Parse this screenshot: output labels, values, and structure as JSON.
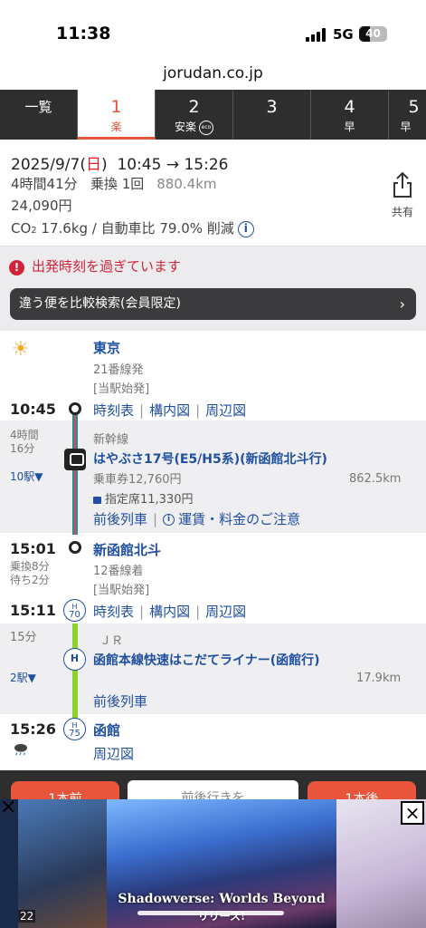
{
  "status_bar": {
    "time": "11:38",
    "network": "5G",
    "battery": "40"
  },
  "browser": {
    "url": "jorudan.co.jp"
  },
  "tabs": [
    {
      "num": "一覧",
      "sub": ""
    },
    {
      "num": "1",
      "sub": "楽"
    },
    {
      "num": "2",
      "sub": "安楽"
    },
    {
      "num": "3",
      "sub": ""
    },
    {
      "num": "4",
      "sub": "早"
    },
    {
      "num": "5",
      "sub": "早"
    }
  ],
  "tab_eco_label": "eco",
  "summary": {
    "date": "2025/9/7(",
    "weekday": "日",
    "date_close": ")",
    "times": "10:45 → 15:26",
    "duration": "4時間41分",
    "transfers": "乗換 1回",
    "distance": "880.4km",
    "fare": "24,090円",
    "co2_a": "CO",
    "co2_b": "2",
    "co2_c": " 17.6kg / 自動車比 79.0% 削減",
    "info_icon": "i",
    "share_label": "共有"
  },
  "warning": {
    "bang": "!",
    "text": "出発時刻を過ぎています"
  },
  "compare": {
    "label": "違う便を比較検索(会員限定)",
    "chevron": "›"
  },
  "route": {
    "weather_start": "sun-icon",
    "station1": {
      "name": "東京",
      "platform": "21番線発",
      "note": "[当駅始発]",
      "time": "10:45",
      "links": [
        "時刻表",
        "構内図",
        "周辺図"
      ]
    },
    "seg1": {
      "duration_a": "4時間",
      "duration_b": "16分",
      "stops": "10駅▼",
      "line_type": "新幹線",
      "train": "はやぶさ17号(E5/H5系)(新函館北斗行)",
      "ticket": "乗車券12,760円",
      "km": "862.5km",
      "reserved": "指定席11,330円",
      "links_a": "前後列車",
      "links_b": "運賃・料金のご注意",
      "info_icon": "i"
    },
    "station2": {
      "name": "新函館北斗",
      "time_arr": "15:01",
      "transfer_a": "乗換8分",
      "transfer_b": "待ち2分",
      "platform": "12番線着",
      "note": "[当駅始発]",
      "time_dep": "15:11",
      "badge_a": "H",
      "badge_b": "70",
      "links": [
        "時刻表",
        "構内図",
        "周辺図"
      ]
    },
    "seg2": {
      "duration": "15分",
      "stops": "2駅▼",
      "operator": "ＪＲ",
      "badge": "H",
      "train": "函館本線快速はこだてライナー(函館行)",
      "km": "17.9km",
      "links": "前後列車"
    },
    "station3": {
      "name": "函館",
      "time": "15:26",
      "badge_a": "H",
      "badge_b": "75",
      "links": "周辺図"
    }
  },
  "bottom": {
    "btn_left": "1本前",
    "btn_center": "前後行きを",
    "btn_right": "1本後"
  },
  "ad": {
    "title": "Shadowverse: Worlds Beyond",
    "subtitle": "リリース!",
    "number": "22",
    "close": "×"
  },
  "colors": {
    "accent": "#e8553b",
    "link": "#1f4fa0",
    "shinkansen_line": "#2b8a8a",
    "jr_line": "#8fd12a",
    "warning": "#d0243a"
  }
}
